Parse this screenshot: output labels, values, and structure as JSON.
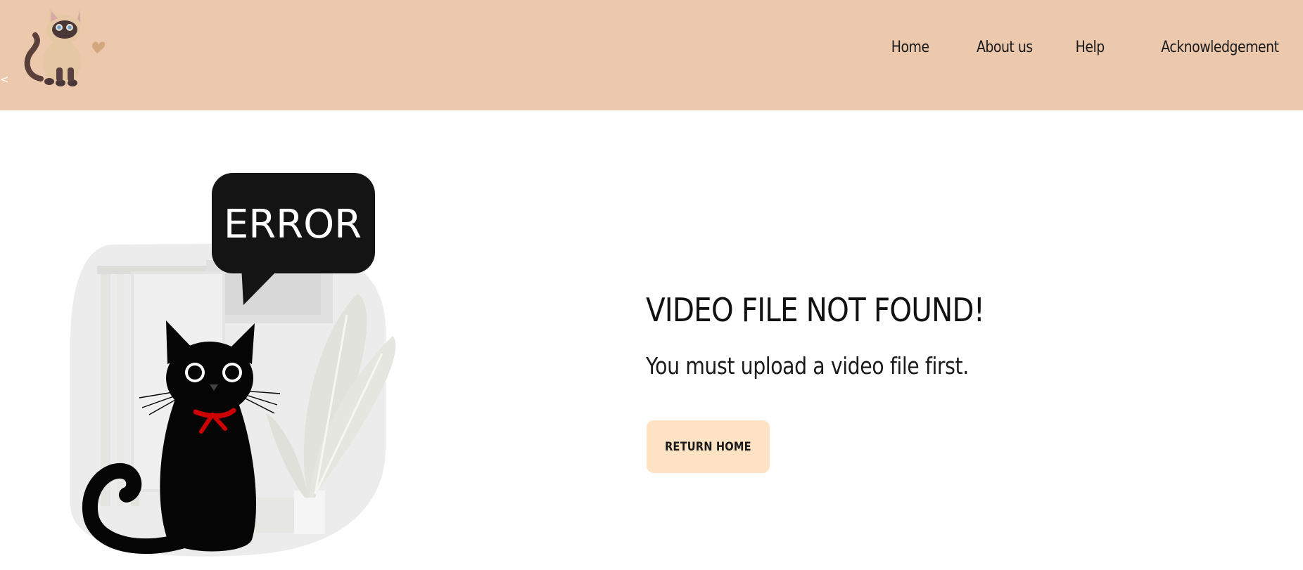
{
  "header": {
    "logo_icon": "siamese-cat-logo-icon",
    "back_chevron": "<",
    "background_color": "#ecc8ad"
  },
  "nav": {
    "items": [
      {
        "label": "Home"
      },
      {
        "label": "About us"
      },
      {
        "label": "Help"
      },
      {
        "label": "Acknowledgement"
      }
    ]
  },
  "illustration": {
    "icon": "black-cat-error-illustration",
    "speech_bubble_text": "ERROR"
  },
  "main": {
    "title": "VIDEO FILE NOT FOUND!",
    "message": "You must upload a video file first.",
    "button_label": "RETURN HOME",
    "button_color": "#fde3c4"
  }
}
